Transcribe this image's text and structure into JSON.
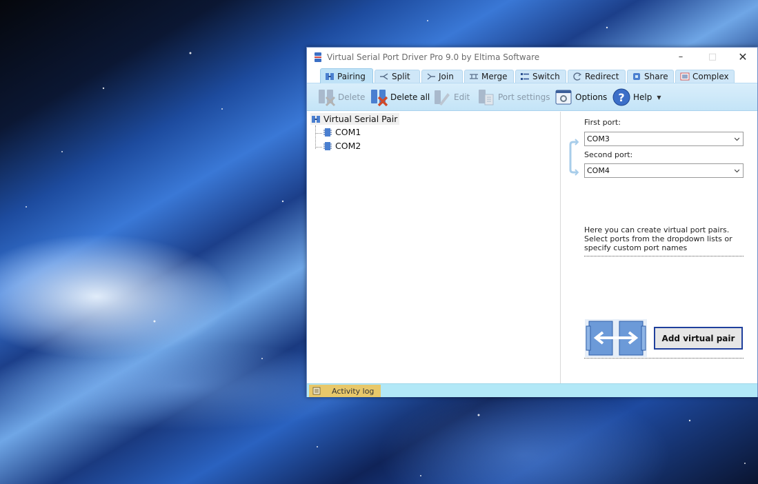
{
  "window": {
    "title": "Virtual Serial Port Driver Pro 9.0 by Eltima Software",
    "controls": {
      "minimize": "–",
      "maximize": "□",
      "close": "✕"
    }
  },
  "tabs": [
    {
      "label": "Pairing",
      "icon": "pairing-icon",
      "active": true
    },
    {
      "label": "Split",
      "icon": "split-icon"
    },
    {
      "label": "Join",
      "icon": "join-icon"
    },
    {
      "label": "Merge",
      "icon": "merge-icon"
    },
    {
      "label": "Switch",
      "icon": "switch-icon"
    },
    {
      "label": "Redirect",
      "icon": "redirect-icon"
    },
    {
      "label": "Share",
      "icon": "share-icon"
    },
    {
      "label": "Complex",
      "icon": "complex-icon"
    }
  ],
  "toolbar": {
    "delete": "Delete",
    "delete_all": "Delete all",
    "edit": "Edit",
    "port_settings": "Port settings",
    "options": "Options",
    "help": "Help"
  },
  "tree": {
    "root": "Virtual Serial Pair",
    "children": [
      "COM1",
      "COM2"
    ]
  },
  "panel": {
    "first_port_label": "First port:",
    "first_port_value": "COM3",
    "second_port_label": "Second port:",
    "second_port_value": "COM4",
    "description": "Here you can create virtual port pairs. Select ports from the dropdown lists or specify custom port names",
    "add_button": "Add virtual pair"
  },
  "activity": {
    "label": "Activity log"
  },
  "colors": {
    "tab_bg": "#cfe7f8",
    "toolbar_bg": "#c4e4f7",
    "activity_bg": "#b2e8f7",
    "activity_tab": "#e8c86a",
    "button_border": "#1f3f9c"
  }
}
